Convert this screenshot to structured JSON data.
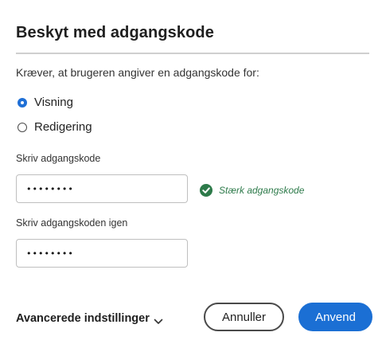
{
  "dialog": {
    "title": "Beskyt med adgangskode",
    "description": "Kræver, at brugeren angiver en adgangskode for:",
    "options": [
      {
        "label": "Visning",
        "checked": true
      },
      {
        "label": "Redigering",
        "checked": false
      }
    ],
    "password_label": "Skriv adgangskode",
    "password_value": "••••••••",
    "confirm_label": "Skriv adgangskoden igen",
    "confirm_value": "••••••••",
    "strength_text": "Stærk adgangskode",
    "strength_icon": "check-circle-icon",
    "advanced_label": "Avancerede indstillinger",
    "advanced_icon": "chevron-down-icon",
    "cancel_label": "Annuller",
    "apply_label": "Anvend"
  },
  "colors": {
    "accent": "#1b6fd4",
    "success": "#2d7a4a",
    "divider": "#cfcfcf"
  }
}
